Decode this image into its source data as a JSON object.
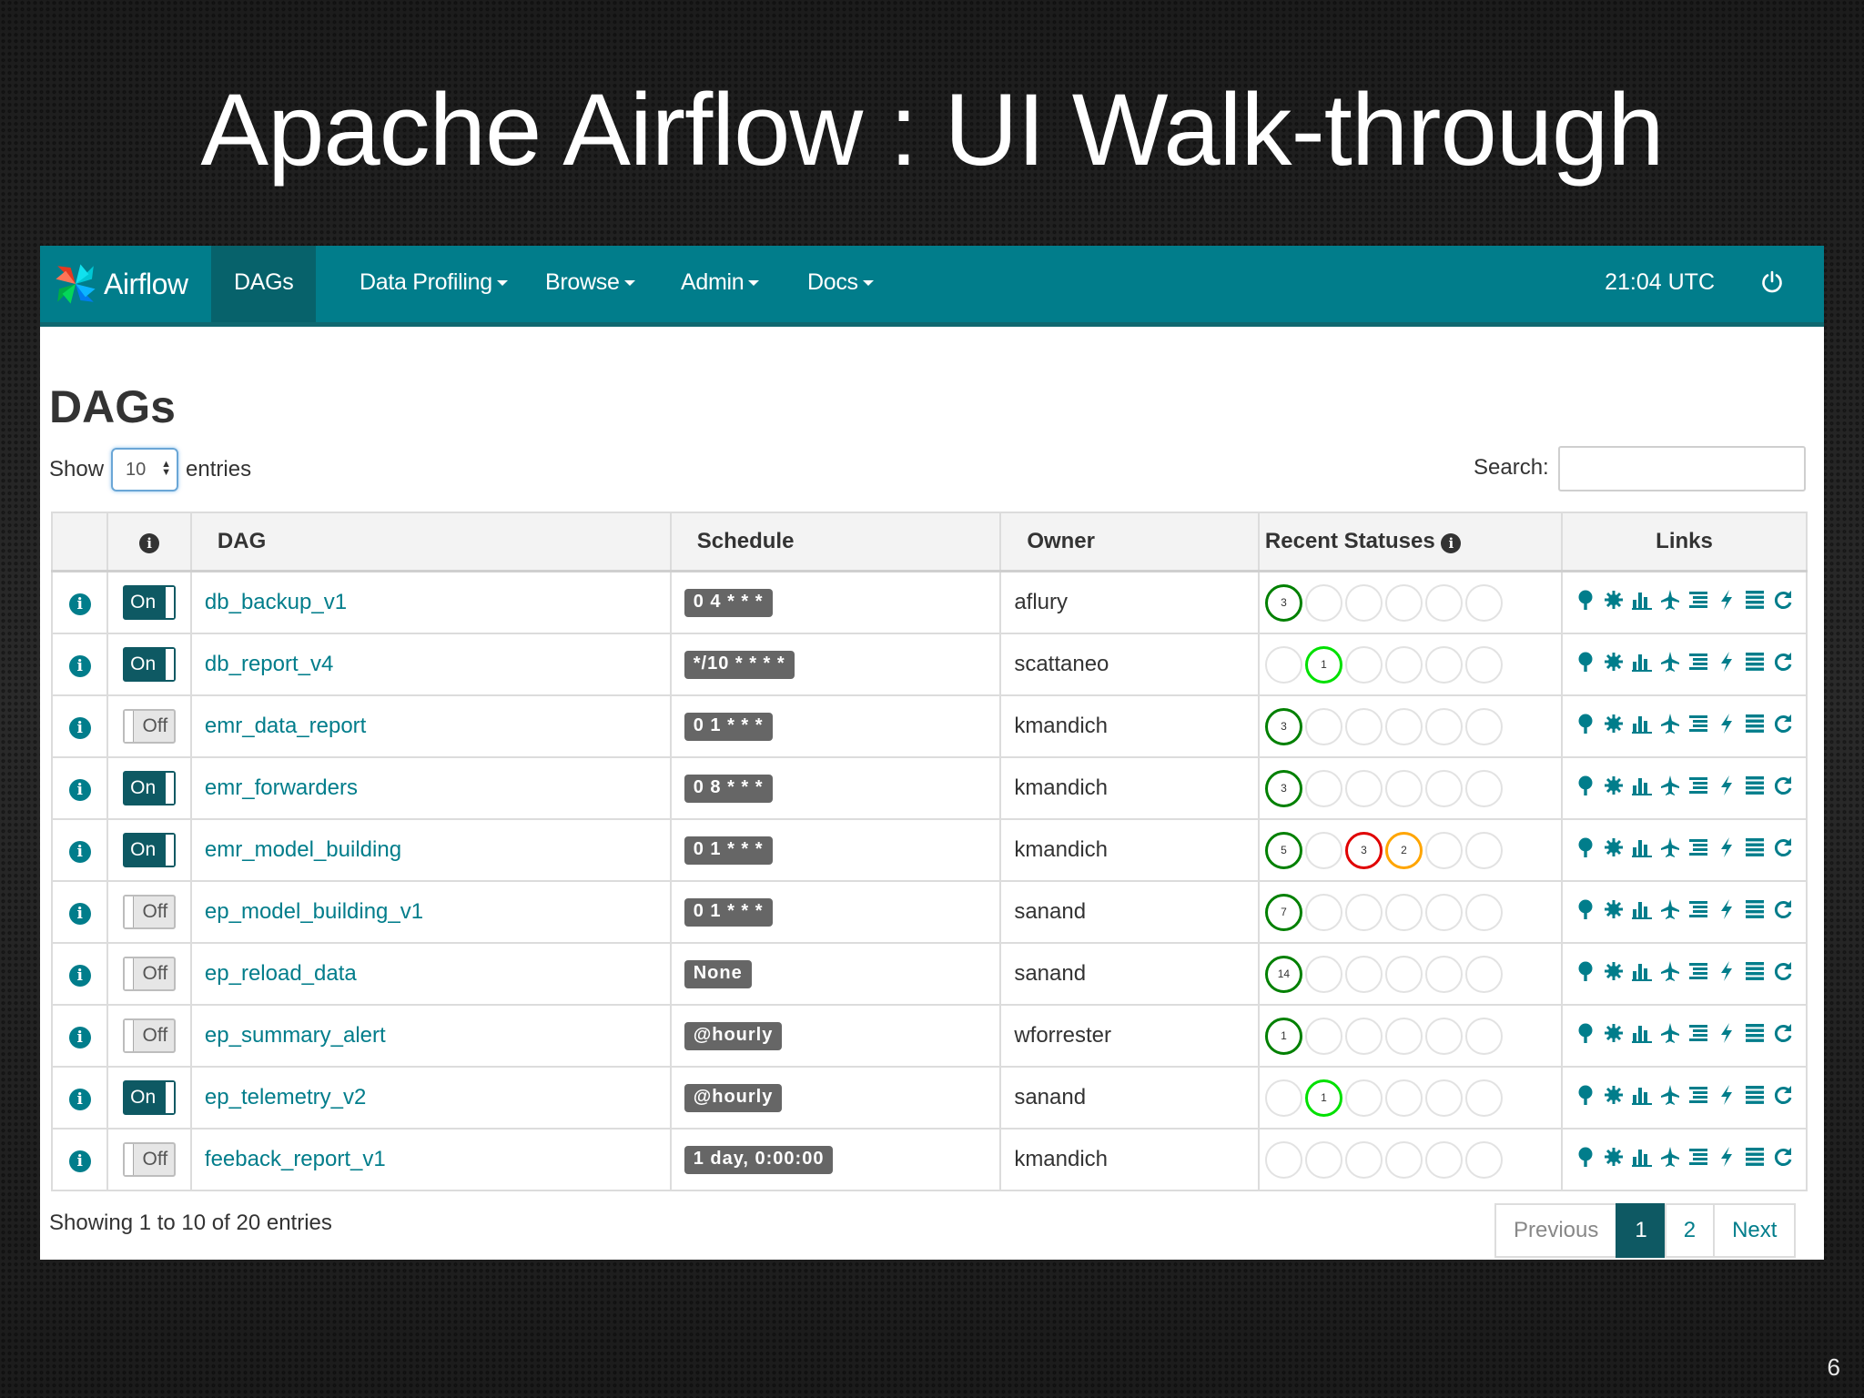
{
  "slide": {
    "title": "Apache Airflow : UI Walk-through",
    "number": "6"
  },
  "navbar": {
    "brand": "Airflow",
    "items": [
      {
        "label": "DAGs",
        "active": true,
        "dropdown": false
      },
      {
        "label": "Data Profiling",
        "active": false,
        "dropdown": true
      },
      {
        "label": "Browse",
        "active": false,
        "dropdown": true
      },
      {
        "label": "Admin",
        "active": false,
        "dropdown": true
      },
      {
        "label": "Docs",
        "active": false,
        "dropdown": true
      }
    ],
    "time": "21:04 UTC",
    "power_icon": "power-icon"
  },
  "page": {
    "heading": "DAGs"
  },
  "controls": {
    "show_label": "Show",
    "show_value": "10",
    "entries_label": "entries",
    "search_label": "Search:",
    "search_value": ""
  },
  "table": {
    "headers": {
      "dag": "DAG",
      "schedule": "Schedule",
      "owner": "Owner",
      "statuses": "Recent Statuses",
      "links": "Links"
    },
    "rows": [
      {
        "on": true,
        "toggle": "On",
        "dag": "db_backup_v1",
        "schedule": "0 4 * * *",
        "owner": "aflury",
        "statuses": [
          {
            "count": "3",
            "state": "success"
          },
          {},
          {},
          {},
          {},
          {}
        ]
      },
      {
        "on": true,
        "toggle": "On",
        "dag": "db_report_v4",
        "schedule": "*/10 * * * *",
        "owner": "scattaneo",
        "statuses": [
          {},
          {
            "count": "1",
            "state": "running"
          },
          {},
          {},
          {},
          {}
        ]
      },
      {
        "on": false,
        "toggle": "Off",
        "dag": "emr_data_report",
        "schedule": "0 1 * * *",
        "owner": "kmandich",
        "statuses": [
          {
            "count": "3",
            "state": "success"
          },
          {},
          {},
          {},
          {},
          {}
        ]
      },
      {
        "on": true,
        "toggle": "On",
        "dag": "emr_forwarders",
        "schedule": "0 8 * * *",
        "owner": "kmandich",
        "statuses": [
          {
            "count": "3",
            "state": "success"
          },
          {},
          {},
          {},
          {},
          {}
        ]
      },
      {
        "on": true,
        "toggle": "On",
        "dag": "emr_model_building",
        "schedule": "0 1 * * *",
        "owner": "kmandich",
        "statuses": [
          {
            "count": "5",
            "state": "success"
          },
          {},
          {
            "count": "3",
            "state": "failed"
          },
          {
            "count": "2",
            "state": "upstream_failed"
          },
          {},
          {}
        ]
      },
      {
        "on": false,
        "toggle": "Off",
        "dag": "ep_model_building_v1",
        "schedule": "0 1 * * *",
        "owner": "sanand",
        "statuses": [
          {
            "count": "7",
            "state": "success"
          },
          {},
          {},
          {},
          {},
          {}
        ]
      },
      {
        "on": false,
        "toggle": "Off",
        "dag": "ep_reload_data",
        "schedule": "None",
        "owner": "sanand",
        "statuses": [
          {
            "count": "14",
            "state": "success"
          },
          {},
          {},
          {},
          {},
          {}
        ]
      },
      {
        "on": false,
        "toggle": "Off",
        "dag": "ep_summary_alert",
        "schedule": "@hourly",
        "owner": "wforrester",
        "statuses": [
          {
            "count": "1",
            "state": "success"
          },
          {},
          {},
          {},
          {},
          {}
        ]
      },
      {
        "on": true,
        "toggle": "On",
        "dag": "ep_telemetry_v2",
        "schedule": "@hourly",
        "owner": "sanand",
        "statuses": [
          {},
          {
            "count": "1",
            "state": "running"
          },
          {},
          {},
          {},
          {}
        ]
      },
      {
        "on": false,
        "toggle": "Off",
        "dag": "feeback_report_v1",
        "schedule": "1 day, 0:00:00",
        "owner": "kmandich",
        "statuses": [
          {},
          {},
          {},
          {},
          {},
          {}
        ]
      }
    ],
    "link_icons": [
      "tree-view-icon",
      "graph-view-icon",
      "duration-chart-icon",
      "gantt-icon",
      "code-view-icon",
      "trigger-dag-icon",
      "logs-icon",
      "refresh-icon"
    ]
  },
  "footer": {
    "info": "Showing 1 to 10 of 20 entries",
    "pages": [
      {
        "label": "Previous",
        "kind": "disabled"
      },
      {
        "label": "1",
        "kind": "current"
      },
      {
        "label": "2",
        "kind": "page"
      },
      {
        "label": "Next",
        "kind": "page"
      }
    ]
  },
  "colors": {
    "brand": "#017d8b",
    "success": "#008000",
    "running": "#00e000",
    "failed": "#e00000",
    "upstream_failed": "#ffa500",
    "empty": "#e2e2e2"
  }
}
